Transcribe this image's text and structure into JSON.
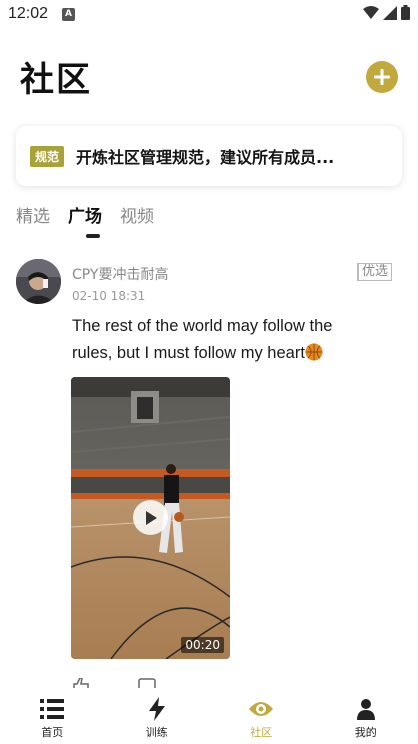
{
  "status_bar": {
    "time": "12:02"
  },
  "header": {
    "title": "社区"
  },
  "announcement": {
    "badge": "规范",
    "text": "开炼社区管理规范，建议所有成员..."
  },
  "tabs": [
    {
      "label": "精选"
    },
    {
      "label": "广场"
    },
    {
      "label": "视频"
    }
  ],
  "active_tab": "广场",
  "post": {
    "author": "CPY要冲击耐高",
    "time": "02-10 18:31",
    "badge": "优选",
    "text": "The rest of the world may follow the rules, but I must follow my heart",
    "video_duration": "00:20"
  },
  "bottom_nav": [
    {
      "label": "首页",
      "icon": "list-icon"
    },
    {
      "label": "训练",
      "icon": "lightning-icon"
    },
    {
      "label": "社区",
      "icon": "eye-icon"
    },
    {
      "label": "我的",
      "icon": "person-icon"
    }
  ],
  "active_nav": "社区",
  "colors": {
    "accent": "#c2a93f",
    "badge": "#a9a238"
  }
}
